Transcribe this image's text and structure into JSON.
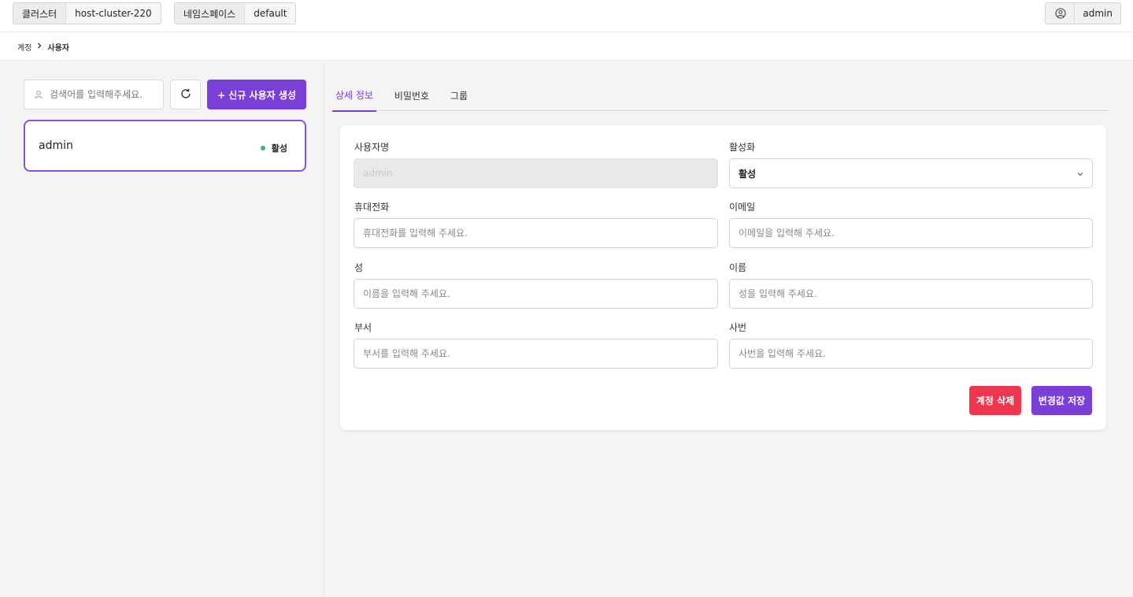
{
  "header": {
    "cluster_label": "클러스터",
    "cluster_value": "host-cluster-220",
    "namespace_label": "네임스페이스",
    "namespace_value": "default",
    "user_name": "admin"
  },
  "breadcrumb": {
    "parent": "계정",
    "separator": ">",
    "current": "사용자"
  },
  "sidebar": {
    "search_placeholder": "검색어를 입력해주세요.",
    "new_user_button": "+ 신규 사용자 생성",
    "users": [
      {
        "name": "admin",
        "status": "활성",
        "status_color": "#3fb27f"
      }
    ]
  },
  "tabs": [
    {
      "label": "상세 정보",
      "active": true
    },
    {
      "label": "비밀번호",
      "active": false
    },
    {
      "label": "그룹",
      "active": false
    }
  ],
  "form": {
    "username": {
      "label": "사용자명",
      "value": "admin"
    },
    "activation": {
      "label": "활성화",
      "value": "활성"
    },
    "phone": {
      "label": "휴대전화",
      "placeholder": "휴대전화를 입력해 주세요."
    },
    "email": {
      "label": "이메일",
      "placeholder": "이메일을 입력해 주세요."
    },
    "last_name": {
      "label": "성",
      "placeholder": "이름을 입력해 주세요."
    },
    "first_name": {
      "label": "이름",
      "placeholder": "성을 입력해 주세요."
    },
    "department": {
      "label": "부서",
      "placeholder": "부서를 입력해 주세요."
    },
    "employee_id": {
      "label": "사번",
      "placeholder": "사번을 입력해 주세요."
    },
    "delete_button": "계정 삭제",
    "save_button": "변경값 저장"
  },
  "colors": {
    "accent": "#7a3fd6",
    "danger": "#f0364e",
    "active_status": "#3fb27f"
  }
}
